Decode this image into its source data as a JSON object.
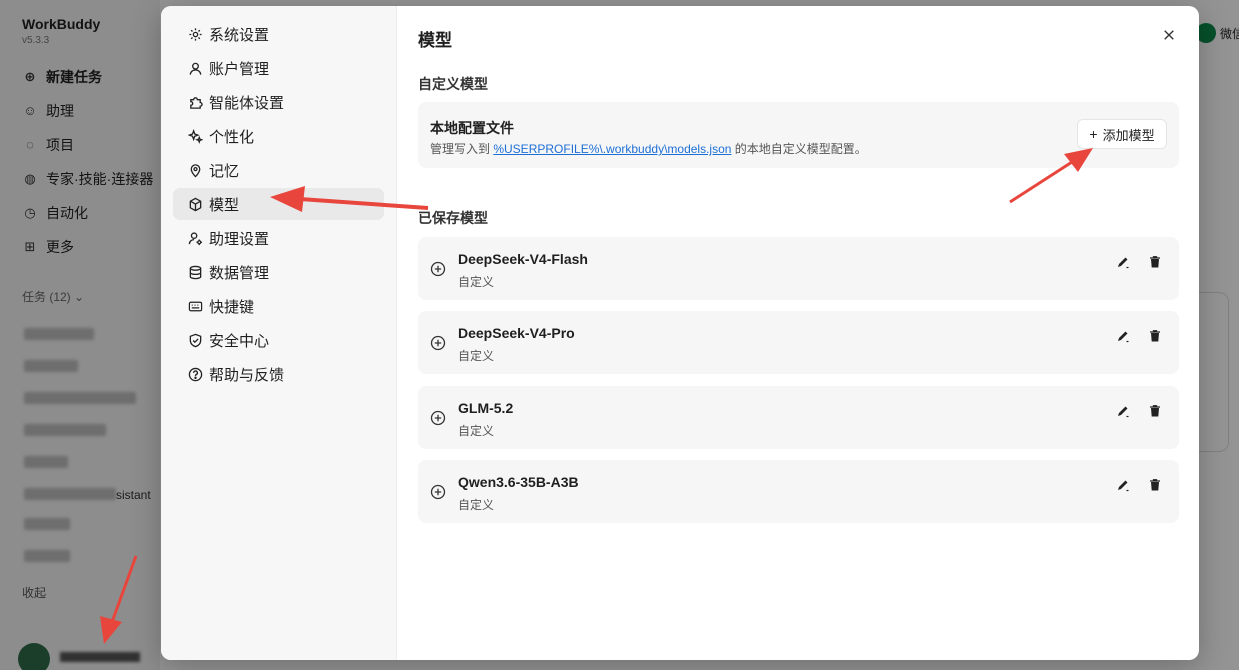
{
  "app": {
    "title": "WorkBuddy",
    "version": "v5.3.3",
    "nav": [
      {
        "label": "新建任务"
      },
      {
        "label": "助理"
      },
      {
        "label": "项目"
      },
      {
        "label": "专家·技能·连接器"
      },
      {
        "label": "自动化"
      },
      {
        "label": "更多"
      }
    ],
    "tasks_label": "任务 (12)",
    "assistant_fragment": "sistant",
    "collapse_label": "收起",
    "right_chip": "微信"
  },
  "settings_nav": [
    {
      "label": "系统设置",
      "icon": "gear-icon"
    },
    {
      "label": "账户管理",
      "icon": "user-icon"
    },
    {
      "label": "智能体设置",
      "icon": "puzzle-icon"
    },
    {
      "label": "个性化",
      "icon": "sparkle-icon"
    },
    {
      "label": "记忆",
      "icon": "pin-icon"
    },
    {
      "label": "模型",
      "icon": "cube-icon",
      "active": true
    },
    {
      "label": "助理设置",
      "icon": "user-gear-icon"
    },
    {
      "label": "数据管理",
      "icon": "database-icon"
    },
    {
      "label": "快捷键",
      "icon": "keyboard-icon"
    },
    {
      "label": "安全中心",
      "icon": "shield-icon"
    },
    {
      "label": "帮助与反馈",
      "icon": "help-icon"
    }
  ],
  "content": {
    "title": "模型",
    "custom_section": "自定义模型",
    "config": {
      "title": "本地配置文件",
      "desc_prefix": "管理写入到 ",
      "path": "%USERPROFILE%\\.workbuddy\\models.json",
      "desc_suffix": " 的本地自定义模型配置。",
      "add_plus": "+",
      "add_label": "添加模型"
    },
    "saved_section": "已保存模型",
    "models": [
      {
        "name": "DeepSeek-V4-Flash",
        "tag": "自定义"
      },
      {
        "name": "DeepSeek-V4-Pro",
        "tag": "自定义"
      },
      {
        "name": "GLM-5.2",
        "tag": "自定义"
      },
      {
        "name": "Qwen3.6-35B-A3B",
        "tag": "自定义"
      }
    ]
  },
  "colors": {
    "annotation_arrow": "#e8463d",
    "link": "#1d6fd6",
    "active_bg": "#e9e9e9"
  }
}
